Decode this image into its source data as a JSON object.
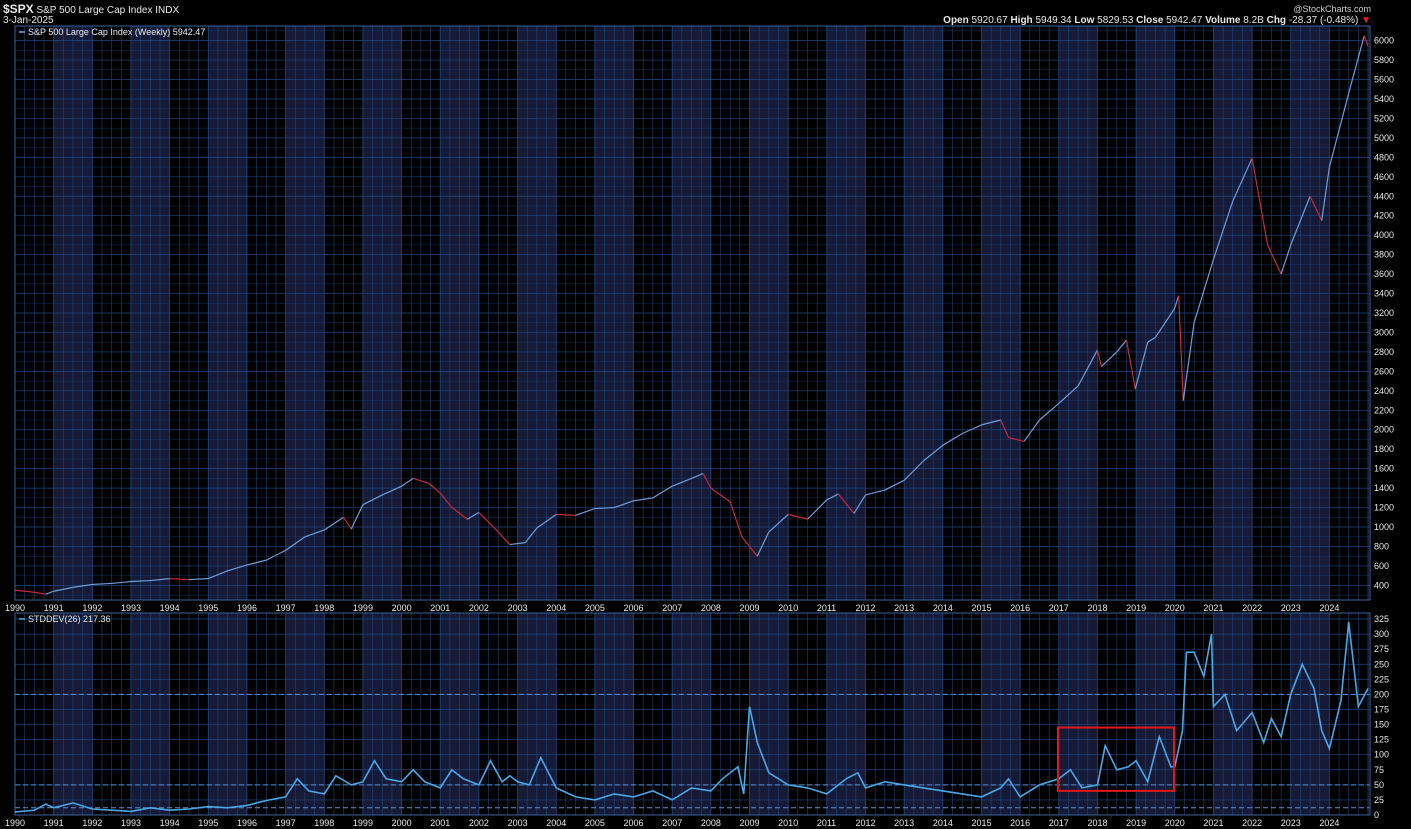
{
  "header": {
    "symbol": "$SPX",
    "name": "S&P 500 Large Cap Index",
    "exchange": "INDX",
    "date": "3-Jan-2025",
    "watermark": "@StockCharts.com",
    "open_label": "Open",
    "open": "5920.67",
    "high_label": "High",
    "high": "5949.34",
    "low_label": "Low",
    "low": "5829.53",
    "close_label": "Close",
    "close": "5942.47",
    "volume_label": "Volume",
    "volume": "8.2B",
    "chg_label": "Chg",
    "chg": "-28.37 (-0.48%)",
    "chg_arrow": "▼"
  },
  "colors": {
    "background": "#000000",
    "grid": "#1e4d8c",
    "band": "#161a36",
    "price_up": "#6f9fdc",
    "price_down": "#c8283c",
    "stddev": "#4aa8e8",
    "highlight_box": "#e01818",
    "text": "#e8e8e8"
  },
  "chart_data": [
    {
      "type": "line",
      "legend": "S&P 500 Large Cap Index (Weekly) 5942.47",
      "x_ticks": [
        "1990",
        "1991",
        "1992",
        "1993",
        "1994",
        "1995",
        "1996",
        "1997",
        "1998",
        "1999",
        "2000",
        "2001",
        "2002",
        "2003",
        "2004",
        "2005",
        "2006",
        "2007",
        "2008",
        "2009",
        "2010",
        "2011",
        "2012",
        "2013",
        "2014",
        "2015",
        "2016",
        "2017",
        "2018",
        "2019",
        "2020",
        "2021",
        "2022",
        "2023",
        "2024"
      ],
      "y_ticks": [
        400,
        600,
        800,
        1000,
        1200,
        1400,
        1600,
        1800,
        2000,
        2200,
        2400,
        2600,
        2800,
        3000,
        3200,
        3400,
        3600,
        3800,
        4000,
        4200,
        4400,
        4600,
        4800,
        5000,
        5200,
        5400,
        5600,
        5800,
        6000
      ],
      "ylim": [
        250,
        6150
      ],
      "xlim": [
        1990.0,
        2025.05
      ],
      "series": [
        {
          "x": [
            1990.0,
            1990.5,
            1990.8,
            1991.0,
            1991.5,
            1992.0,
            1992.5,
            1993.0,
            1993.5,
            1994.0,
            1994.5,
            1995.0,
            1995.5,
            1996.0,
            1996.5,
            1997.0,
            1997.5,
            1998.0,
            1998.5,
            1998.7,
            1999.0,
            1999.5,
            2000.0,
            2000.3,
            2000.7,
            2001.0,
            2001.3,
            2001.7,
            2002.0,
            2002.5,
            2002.8,
            2003.2,
            2003.5,
            2004.0,
            2004.5,
            2005.0,
            2005.5,
            2006.0,
            2006.5,
            2007.0,
            2007.5,
            2007.8,
            2008.0,
            2008.5,
            2008.8,
            2009.0,
            2009.2,
            2009.5,
            2010.0,
            2010.5,
            2011.0,
            2011.3,
            2011.7,
            2012.0,
            2012.5,
            2013.0,
            2013.5,
            2014.0,
            2014.5,
            2015.0,
            2015.5,
            2015.7,
            2016.1,
            2016.5,
            2017.0,
            2017.5,
            2018.0,
            2018.1,
            2018.5,
            2018.75,
            2018.98,
            2019.3,
            2019.5,
            2020.0,
            2020.1,
            2020.22,
            2020.5,
            2021.0,
            2021.5,
            2022.0,
            2022.4,
            2022.75,
            2023.0,
            2023.5,
            2023.8,
            2024.0,
            2024.5,
            2024.9,
            2025.0
          ],
          "y": [
            350,
            330,
            310,
            340,
            380,
            410,
            420,
            440,
            450,
            470,
            460,
            470,
            550,
            610,
            660,
            760,
            900,
            970,
            1100,
            980,
            1230,
            1330,
            1420,
            1500,
            1450,
            1350,
            1200,
            1080,
            1150,
            950,
            820,
            840,
            990,
            1130,
            1120,
            1190,
            1200,
            1270,
            1300,
            1420,
            1500,
            1550,
            1400,
            1260,
            900,
            800,
            700,
            950,
            1130,
            1080,
            1280,
            1340,
            1140,
            1330,
            1380,
            1480,
            1680,
            1840,
            1960,
            2050,
            2100,
            1920,
            1880,
            2100,
            2270,
            2450,
            2820,
            2650,
            2800,
            2920,
            2420,
            2900,
            2950,
            3250,
            3380,
            2300,
            3100,
            3750,
            4350,
            4790,
            3900,
            3600,
            3900,
            4400,
            4150,
            4700,
            5460,
            6050,
            5942
          ]
        }
      ]
    },
    {
      "type": "line",
      "legend": "STDDEV(26) 217.36",
      "x_ticks": [
        "1990",
        "1991",
        "1992",
        "1993",
        "1994",
        "1995",
        "1996",
        "1997",
        "1998",
        "1999",
        "2000",
        "2001",
        "2002",
        "2003",
        "2004",
        "2005",
        "2006",
        "2007",
        "2008",
        "2009",
        "2010",
        "2011",
        "2012",
        "2013",
        "2014",
        "2015",
        "2016",
        "2017",
        "2018",
        "2019",
        "2020",
        "2021",
        "2022",
        "2023",
        "2024"
      ],
      "y_ticks": [
        0,
        25,
        50,
        75,
        100,
        125,
        150,
        175,
        200,
        225,
        250,
        275,
        300,
        325
      ],
      "ylim": [
        0,
        335
      ],
      "xlim": [
        1990.0,
        2025.05
      ],
      "reference_lines": [
        200,
        50,
        12
      ],
      "series": [
        {
          "x": [
            1990.0,
            1990.5,
            1990.8,
            1991.0,
            1991.5,
            1992.0,
            1992.5,
            1993.0,
            1993.5,
            1994.0,
            1994.5,
            1995.0,
            1995.5,
            1996.0,
            1996.5,
            1997.0,
            1997.3,
            1997.6,
            1998.0,
            1998.3,
            1998.7,
            1999.0,
            1999.3,
            1999.6,
            2000.0,
            2000.3,
            2000.6,
            2001.0,
            2001.3,
            2001.6,
            2002.0,
            2002.3,
            2002.6,
            2002.8,
            2003.0,
            2003.3,
            2003.6,
            2004.0,
            2004.5,
            2005.0,
            2005.5,
            2006.0,
            2006.5,
            2007.0,
            2007.5,
            2008.0,
            2008.3,
            2008.7,
            2008.85,
            2009.0,
            2009.2,
            2009.5,
            2010.0,
            2010.5,
            2011.0,
            2011.5,
            2011.8,
            2012.0,
            2012.5,
            2013.0,
            2013.5,
            2014.0,
            2014.5,
            2015.0,
            2015.5,
            2015.7,
            2016.0,
            2016.5,
            2017.0,
            2017.3,
            2017.6,
            2018.0,
            2018.2,
            2018.5,
            2018.8,
            2019.0,
            2019.3,
            2019.6,
            2019.9,
            2020.0,
            2020.2,
            2020.3,
            2020.5,
            2020.75,
            2020.95,
            2021.0,
            2021.3,
            2021.6,
            2022.0,
            2022.3,
            2022.5,
            2022.75,
            2023.0,
            2023.3,
            2023.6,
            2023.8,
            2024.0,
            2024.3,
            2024.5,
            2024.75,
            2025.0
          ],
          "y": [
            5,
            8,
            18,
            12,
            20,
            10,
            8,
            6,
            12,
            8,
            10,
            14,
            12,
            16,
            24,
            30,
            60,
            40,
            35,
            65,
            50,
            55,
            90,
            60,
            55,
            75,
            55,
            45,
            75,
            60,
            50,
            90,
            55,
            65,
            55,
            50,
            95,
            45,
            30,
            25,
            35,
            30,
            40,
            25,
            45,
            40,
            60,
            80,
            35,
            180,
            120,
            70,
            50,
            45,
            35,
            60,
            70,
            45,
            55,
            50,
            45,
            40,
            35,
            30,
            45,
            60,
            30,
            50,
            60,
            75,
            45,
            50,
            115,
            75,
            80,
            90,
            55,
            130,
            80,
            80,
            140,
            270,
            270,
            230,
            300,
            180,
            200,
            140,
            170,
            120,
            160,
            130,
            200,
            250,
            210,
            140,
            110,
            190,
            320,
            180,
            210
          ]
        }
      ],
      "annotation": "red rectangle around 2017–2020, value range 40–145"
    }
  ]
}
